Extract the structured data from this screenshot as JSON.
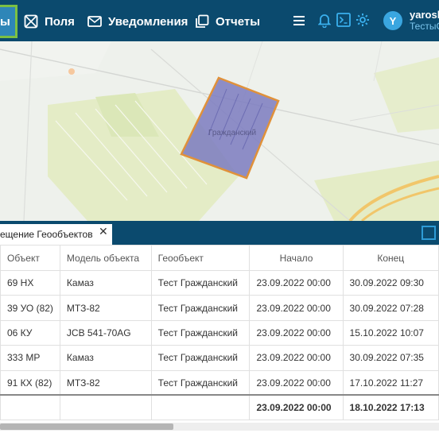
{
  "nav": {
    "active_fragment": "ы",
    "fields_label": "Поля",
    "notifications_label": "Уведомления",
    "reports_label": "Отчеты",
    "user_initial": "Y",
    "user_name": "yarosh",
    "user_sub": "ТестыС"
  },
  "map": {
    "field_label": "Гражданский",
    "field_fill_color": "#7b7bc0",
    "field_border_color": "#e0913a"
  },
  "panel": {
    "tab_label": "ещение Геообъектов",
    "close_glyph": "✕"
  },
  "table": {
    "headers": [
      "Объект",
      "Модель объекта",
      "Геообъект",
      "Начало",
      "Конец"
    ],
    "rows": [
      [
        "69 НХ",
        "Камаз",
        "Тест Гражданский",
        "23.09.2022 00:00",
        "30.09.2022 09:30"
      ],
      [
        "39 УО (82)",
        "МТЗ-82",
        "Тест Гражданский",
        "23.09.2022 00:00",
        "30.09.2022 07:28"
      ],
      [
        "06 КУ",
        "JCB 541-70AG",
        "Тест Гражданский",
        "23.09.2022 00:00",
        "15.10.2022 10:07"
      ],
      [
        "333 МР",
        "Камаз",
        "Тест Гражданский",
        "23.09.2022 00:00",
        "30.09.2022 07:35"
      ],
      [
        "91 КХ (82)",
        "МТЗ-82",
        "Тест Гражданский",
        "23.09.2022 00:00",
        "17.10.2022 11:27"
      ]
    ],
    "total": [
      "",
      "",
      "",
      "23.09.2022 00:00",
      "18.10.2022 17:13"
    ]
  }
}
